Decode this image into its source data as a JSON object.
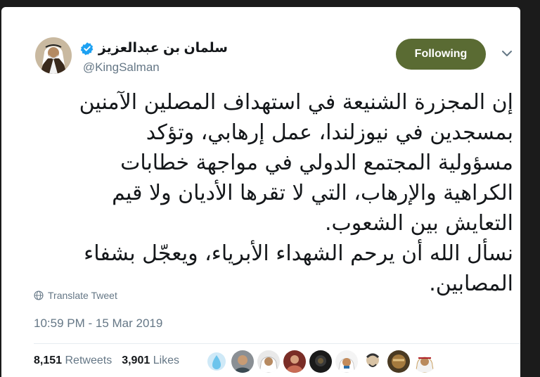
{
  "profile": {
    "display_name": "سلمان بن عبدالعزيز",
    "handle": "@KingSalman",
    "verified": true
  },
  "follow_button": {
    "label": "Following"
  },
  "tweet": {
    "lines": [
      "إن المجزرة الشنيعة في استهداف المصلين الآمنين",
      "بمسجدين في نيوزلندا، عمل إرهابي، وتؤكد",
      "مسؤولية المجتمع الدولي في مواجهة خطابات",
      "الكراهية والإرهاب، التي لا تقرها الأديان ولا قيم",
      "التعايش بين الشعوب.",
      "نسأل الله أن يرحم الشهداء الأبرياء، ويعجّل بشفاء",
      "المصابين."
    ]
  },
  "translate": {
    "label": "Translate Tweet"
  },
  "timestamp": "10:59 PM - 15 Mar 2019",
  "stats": {
    "retweets_count": "8,151",
    "retweets_label": "Retweets",
    "likes_count": "3,901",
    "likes_label": "Likes"
  },
  "colors": {
    "follow_button": "#5a6b33",
    "verified_badge": "#1da1f2",
    "secondary_text": "#657786"
  }
}
